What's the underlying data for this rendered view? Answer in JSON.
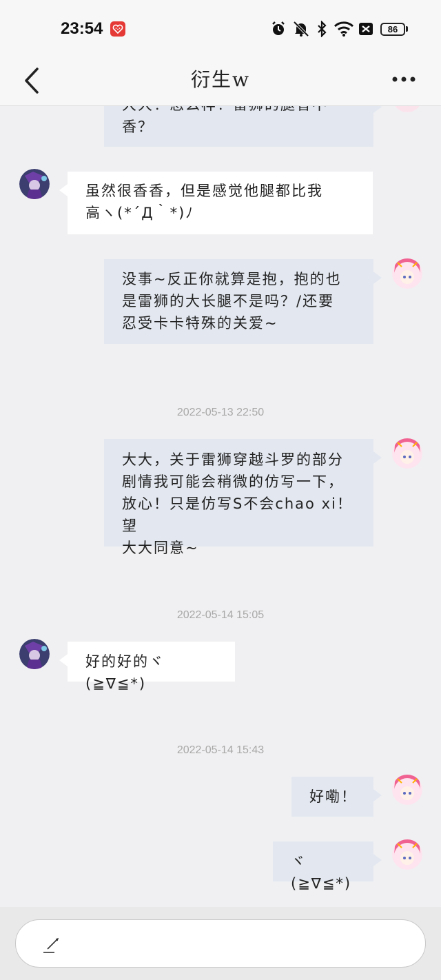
{
  "status_bar": {
    "time": "23:54",
    "battery": "86",
    "icons": [
      "app-heart-icon",
      "alarm-icon",
      "mute-icon",
      "bluetooth-icon",
      "wifi-icon",
      "no-sim-icon",
      "battery-icon"
    ]
  },
  "header": {
    "title": "衍生w",
    "back_icon": "chevron-left-icon",
    "more_icon": "more-horizontal-icon"
  },
  "messages": [
    {
      "side": "out",
      "lines": [
        "大大！怎么样！雷狮的腿香不",
        "香？"
      ]
    },
    {
      "side": "in",
      "lines": [
        "虽然很香香，但是感觉他腿都比我",
        "高ヽ(*´Д｀*)ﾉ"
      ]
    },
    {
      "side": "out",
      "lines": [
        "没事~反正你就算是抱，抱的也",
        "是雷狮的大长腿不是吗？/还要",
        "忍受卡卡特殊的关爱~"
      ]
    },
    {
      "side": "out",
      "lines": [
        "大大，关于雷狮穿越斗罗的部分",
        "剧情我可能会稍微的仿写一下，",
        "放心！只是仿写S不会chao xi！望",
        "大大同意~"
      ]
    },
    {
      "side": "in",
      "lines": [
        "好的好的ヾ(≧∇≦*)"
      ]
    },
    {
      "side": "out",
      "lines": [
        "好嘞！"
      ]
    },
    {
      "side": "out",
      "lines": [
        "ヾ(≧∇≦*)"
      ]
    }
  ],
  "timestamps": [
    "2022-05-13 22:50",
    "2022-05-14 15:05",
    "2022-05-14 15:43"
  ],
  "input": {
    "placeholder": "",
    "icon": "pen-icon"
  },
  "colors": {
    "background": "#f0f0f2",
    "outgoing_bubble": "#e3e8f0",
    "incoming_bubble": "#ffffff",
    "timestamp": "#a8a8a8"
  }
}
